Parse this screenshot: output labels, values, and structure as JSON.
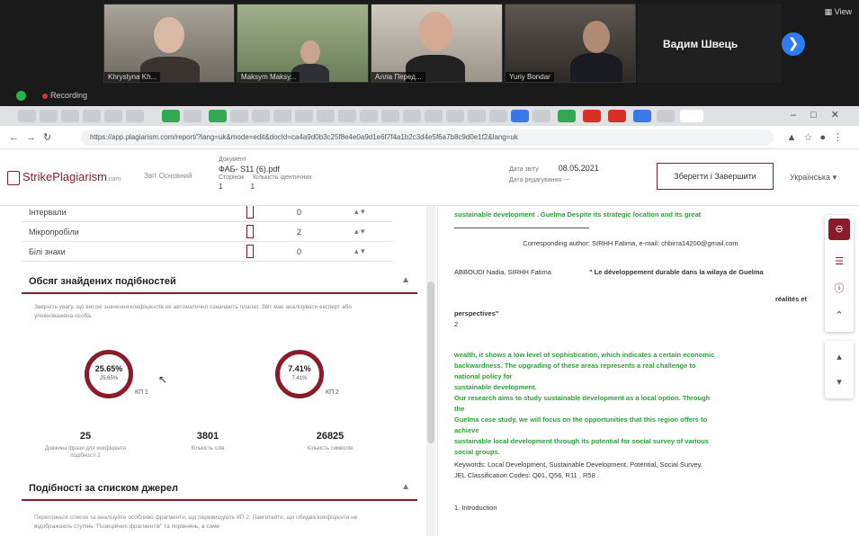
{
  "conference": {
    "participants": [
      {
        "name": "Khrystyna Kh..."
      },
      {
        "name": "Maksym Maksy..."
      },
      {
        "name": "Алла Перед..."
      },
      {
        "name": "Yuriy Bondar"
      }
    ],
    "active_speaker": "Вадим Швець",
    "view_label": "View",
    "recording_label": "Recording"
  },
  "browser": {
    "url": "https://app.plagiarism.com/report/?lang=uk&mode=edit&docId=ca4a9d0b3c25f8e4e0a9d1e6f7f4a1b2c3d4e5f6a7b8c9d0e1f2&lang=uk"
  },
  "header": {
    "logo_text": "StrikePlagiarism",
    "logo_sub": ".com",
    "tool_label": "Звіт Основний",
    "doc_label": "Документ",
    "doc_name": "ФАБ- S11 (6).pdf",
    "count_labels": "Сторінок     Кількість ідентичних",
    "count_values": "1              1",
    "date_label": "Дата звіту",
    "date_value": "08.05.2021",
    "edit_label": "Дата редагування ---",
    "save_button": "Зберегти і Завершити",
    "user_label": "Українська"
  },
  "left": {
    "char_rows": [
      {
        "label": "Інтервали",
        "count": "0"
      },
      {
        "label": "Мікропробіли",
        "count": "2"
      },
      {
        "label": "Білі знаки",
        "count": "0"
      }
    ],
    "similarity_title": "Обсяг знайдених подібностей",
    "similarity_help": "Зверніть увагу, що високі значення коефіцієнтів не автоматично означають плагіат. Звіт має аналізувати експерт або уповноважена особа.",
    "gauges": [
      {
        "value": "25.65%",
        "inner": "25.65%",
        "label": "КП 1"
      },
      {
        "value": "7.41%",
        "inner": "7.41%",
        "label": "КП 2"
      }
    ],
    "stats": [
      {
        "value": "25",
        "label": "Довжина фрази для коефіцієнта подібності 2"
      },
      {
        "value": "3801",
        "label": "Кількість слів"
      },
      {
        "value": "26825",
        "label": "Кількість символів"
      }
    ],
    "sources_title": "Подібності за списком джерел",
    "sources_help": "Перегляньте список та аналізуйте особливо фрагменти, що перевищують КП 2. Пам'ятайте, що обидва коефіцієнти не відображають ступінь \"Позиційних фрагментів\" та порівнянь, а саме"
  },
  "document": {
    "p1": "sustainable development . Guelma Despite its strategic location and its great",
    "corresponding": "Corresponding author: SIRHH Fatima, e-mail: chbirra14200@gmail.com",
    "citation_authors": "ABBOUDI Nadia, SIRHH Fatima",
    "citation_title": "\" Le développement durable dans la wilaya de Guelma",
    "citation_right": "réalités et",
    "citation_end": "perspectives\"",
    "citation_num": "2",
    "green_lines": [
      "wealth, it shows a low level of sophistication, which indicates a certain economic",
      "backwardness. The upgrading of these areas represents a real challenge to",
      "national policy for",
      "sustainable development.",
      "Our research aims to study sustainable development as a local option.    Through",
      "the",
      "Guelma case study, we will focus on the opportunities that this region offers to",
      "achieve",
      "sustainable local development through its potential for social survey of various",
      "social groups."
    ],
    "keywords": "Keywords:  Local Development, Sustainable Development, Potential, Social Survey.",
    "jel": "JEL Classification Codes: Q01, Q56, R11 , R58 .",
    "intro": "1. Introduction"
  }
}
